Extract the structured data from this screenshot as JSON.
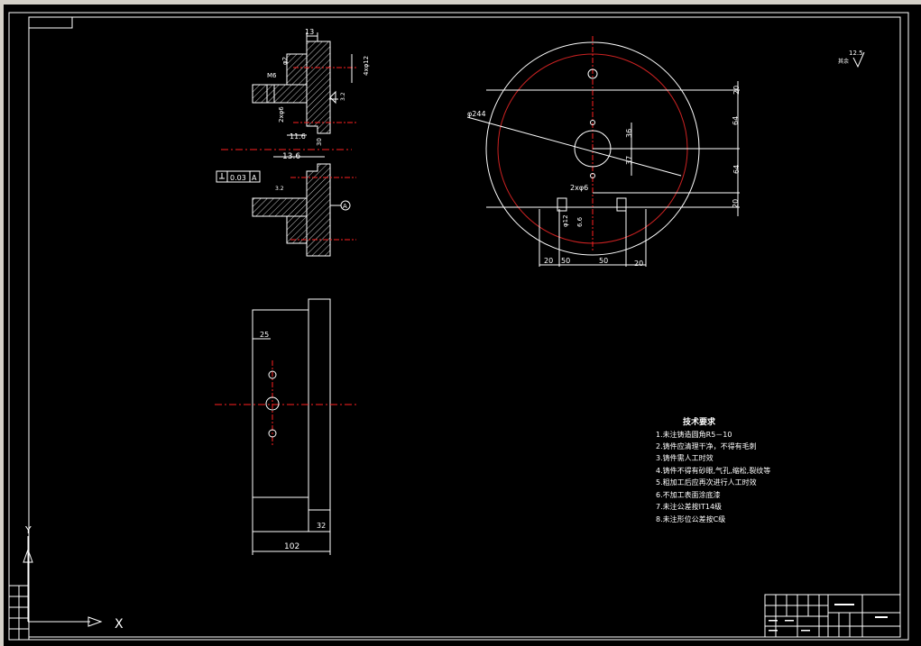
{
  "window": {
    "colors": {
      "background": "#000000",
      "line": "#ffffff",
      "center": "#ff2020",
      "accent": "#cc2222",
      "toolbar": "#d4d0c8"
    }
  },
  "surface_roughness": {
    "value": "12.5",
    "note": "其余"
  },
  "side_view": {
    "dims": [
      "13",
      "φ2",
      "M6",
      "4xφ12",
      "3.2",
      "2xφ6",
      "11.6",
      "30",
      "13.6",
      "0.03",
      "A",
      "3.2"
    ],
    "datum": "A"
  },
  "top_view": {
    "dims": [
      "φ244",
      "20",
      "64",
      "64",
      "20",
      "36",
      "37",
      "2xφ6",
      "φ12",
      "6.6",
      "20",
      "50",
      "50",
      "20"
    ]
  },
  "front_view": {
    "dims": [
      "25",
      "32",
      "102"
    ]
  },
  "tech_requirements": {
    "title": "技术要求",
    "items": [
      "1.未注铸造圆角R5－10",
      "2.铸件应清理干净，不得有毛刺",
      "3.铸件需人工时效",
      "4.铸件不得有砂眼,气孔,缩松,裂纹等",
      "5.粗加工后应再次进行人工时效",
      "6.不加工表面涂底漆",
      "7.未注公差按IT14级",
      "8.未注形位公差按C级"
    ]
  },
  "ucs": {
    "x_label": "X",
    "y_label": "Y"
  }
}
